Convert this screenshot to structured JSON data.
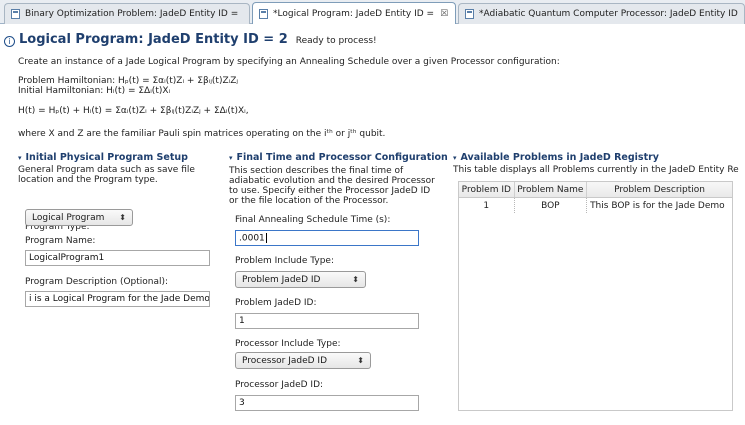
{
  "tabs": [
    {
      "label": "Binary Optimization Problem: JadeD Entity ID =",
      "active": false,
      "closable": false
    },
    {
      "label": "*Logical Program: JadeD Entity ID =",
      "active": true,
      "closable": true,
      "close_glyph": "☒"
    },
    {
      "label": "*Adiabatic Quantum Computer Processor: JadeD Entity ID",
      "active": false,
      "closable": false
    }
  ],
  "header": {
    "info_glyph": "i",
    "title": "Logical Program: JadeD Entity ID = 2",
    "status": "Ready to process!",
    "lines": [
      "Create an instance of a Jade Logical Program by specifying an Annealing Schedule over a given Processor configuration:",
      "Problem Hamiltonian: Hₚ(t) = Σαᵢ(t)Zᵢ + Σβᵢⱼ(t)ZᵢZⱼ",
      "Initial Hamiltonian: Hᵢ(t) = ΣΔᵢ(t)Xᵢ",
      "H(t) = Hₚ(t) + Hᵢ(t) = Σαᵢ(t)Zᵢ + Σβᵢⱼ(t)ZᵢZⱼ + ΣΔᵢ(t)Xᵢ,",
      "where X and Z are the familiar Pauli spin matrices operating on the iᵗʰ or jᵗʰ qubit."
    ]
  },
  "section1": {
    "title": "Initial Physical Program Setup",
    "desc": "General Program data such as save file location and the Program type.",
    "program_type_label": "Program Type:",
    "program_type_value": "Logical Program",
    "program_name_label": "Program Name:",
    "program_name_value": "LogicalProgram1",
    "program_desc_label": "Program Description (Optional):",
    "program_desc_value": "i is a Logical Program for the Jade Demo"
  },
  "section2": {
    "title": "Final Time and Processor Configuration",
    "desc": "This section describes the final time of adiabatic evolution and the desired Processor to use. Specify either the Processor JadeD ID or the file location of the Processor.",
    "anneal_label": "Final Annealing Schedule Time (s):",
    "anneal_value": ".0001",
    "problem_include_label": "Problem Include Type:",
    "problem_include_value": "Problem JadeD ID",
    "problem_id_label": "Problem JadeD ID:",
    "problem_id_value": "1",
    "processor_include_label": "Processor Include Type:",
    "processor_include_value": "Processor JadeD ID",
    "processor_id_label": "Processor JadeD ID:",
    "processor_id_value": "3"
  },
  "section3": {
    "title": "Available Problems in JadeD Registry",
    "desc": "This table displays all Problems currently in the JadeD Entity Re",
    "columns": [
      "Problem ID",
      "Problem Name",
      "Problem Description"
    ],
    "rows": [
      {
        "id": "1",
        "name": "BOP",
        "description": "This BOP is for the Jade Demo"
      }
    ]
  },
  "icons": {
    "twistie": "▾",
    "combo_arrow": "⬍"
  }
}
